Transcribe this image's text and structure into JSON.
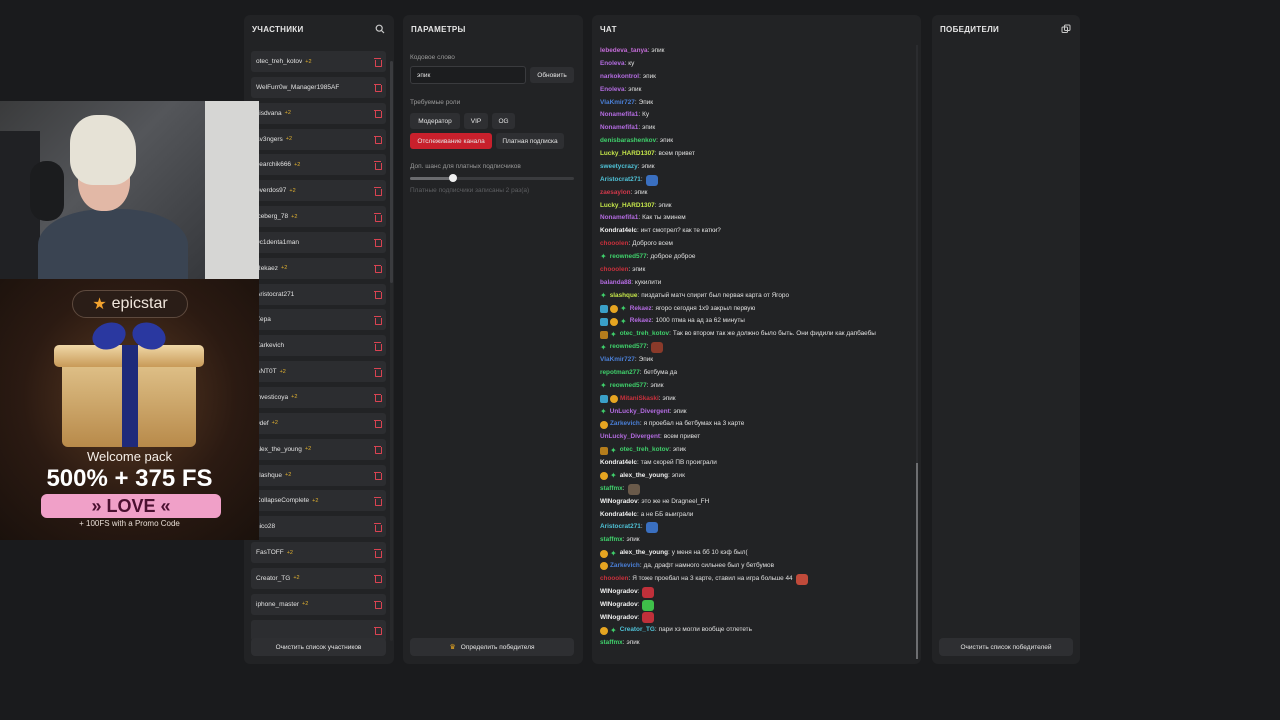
{
  "participants": {
    "title": "УЧАСТНИКИ",
    "search_icon": "search-icon",
    "badge": "+2",
    "items": [
      {
        "name": "otec_treh_kotov",
        "badge": true
      },
      {
        "name": "WelFurr0w_Manager1985AF",
        "badge": false
      },
      {
        "name": "kisdvana",
        "badge": true
      },
      {
        "name": "av3ngers",
        "badge": true
      },
      {
        "name": "searchik666",
        "badge": true
      },
      {
        "name": "overdos97",
        "badge": true
      },
      {
        "name": "iceberg_78",
        "badge": true
      },
      {
        "name": "0c1denta1man",
        "badge": false
      },
      {
        "name": "Rekaez",
        "badge": true
      },
      {
        "name": "Aristocrat271",
        "badge": false
      },
      {
        "name": "Zepa",
        "badge": false
      },
      {
        "name": "Zarkevich",
        "badge": false
      },
      {
        "name": "ANT0T",
        "badge": true
      },
      {
        "name": "investicoya",
        "badge": true
      },
      {
        "name": "0def",
        "badge": true
      },
      {
        "name": "alex_the_young",
        "badge": true
      },
      {
        "name": "slashque",
        "badge": true
      },
      {
        "name": "CollapseComplete",
        "badge": true
      },
      {
        "name": "nico28",
        "badge": false
      },
      {
        "name": "FasTOFF",
        "badge": true
      },
      {
        "name": "Creator_TG",
        "badge": true
      },
      {
        "name": "iphone_master",
        "badge": true
      },
      {
        "name": "",
        "badge": false
      }
    ],
    "clear_button": "Очистить список участников"
  },
  "params": {
    "title": "ПАРАМЕТРЫ",
    "code_word_label": "Кодовое слово",
    "code_word_value": "эпик",
    "update_button": "Обновить",
    "roles_label": "Требуемые роли",
    "roles": [
      "Модератор",
      "VIP",
      "OG"
    ],
    "role_follow": "Отслеживание канала",
    "role_paid": "Платная подписка",
    "chance_label": "Доп. шанс для платных подписчиков",
    "chance_value": 0.26,
    "chance_hint": "Платные подписчики записаны 2 раз(а)",
    "determine_button": "Определить победителя",
    "determine_icon": "crown-icon"
  },
  "chat": {
    "title": "ЧАТ",
    "messages": [
      {
        "user": "lebedeva_tanya",
        "color": "#c26bd6",
        "text": "эпик",
        "badges": []
      },
      {
        "user": "Enoleva",
        "color": "#b36be0",
        "text": "ку",
        "badges": []
      },
      {
        "user": "narkokontrol",
        "color": "#b36be0",
        "text": "эпик",
        "badges": []
      },
      {
        "user": "Enoleva",
        "color": "#b36be0",
        "text": "эпик",
        "badges": []
      },
      {
        "user": "VlaKmir727",
        "color": "#4a7fd6",
        "text": "Эпик",
        "badges": []
      },
      {
        "user": "Nonamefifa1",
        "color": "#b36be0",
        "text": "Ку",
        "badges": []
      },
      {
        "user": "Nonamefifa1",
        "color": "#b36be0",
        "text": "эпик",
        "badges": []
      },
      {
        "user": "denisbarashenkov",
        "color": "#3fd06b",
        "text": "эпик",
        "badges": []
      },
      {
        "user": "Lucky_HARD1307",
        "color": "#c5e64a",
        "text": "всем привет",
        "badges": []
      },
      {
        "user": "sweetycrazy",
        "color": "#4fc1d6",
        "text": "эпик",
        "badges": []
      },
      {
        "user": "Aristocrat271",
        "color": "#4fc1d6",
        "text": "",
        "badges": [],
        "emote": "#3a6fc0"
      },
      {
        "user": "zaesaylon",
        "color": "#d0384a",
        "text": "эпик",
        "badges": []
      },
      {
        "user": "Lucky_HARD1307",
        "color": "#c5e64a",
        "text": "эпик",
        "badges": []
      },
      {
        "user": "Nonamefifa1",
        "color": "#b36be0",
        "text": "Как ты зминем",
        "badges": []
      },
      {
        "user": "Kondrat4elc",
        "color": "#f0f0f0",
        "text": "инт смотрел? как те катки?",
        "badges": []
      },
      {
        "user": "chooolen",
        "color": "#c8303c",
        "text": "Доброго всем",
        "badges": []
      },
      {
        "user": "reowned577",
        "color": "#3fd06b",
        "text": "доброе доброе",
        "badges": [
          "green"
        ]
      },
      {
        "user": "chooolen",
        "color": "#c8303c",
        "text": "эпик",
        "badges": []
      },
      {
        "user": "balanda88",
        "color": "#b36be0",
        "text": "кукилити",
        "badges": []
      },
      {
        "user": "slashque",
        "color": "#c5e64a",
        "text": "пиздатый матч спирит был первая карта от Ягоро",
        "badges": [
          "green"
        ]
      },
      {
        "user": "Rekaez",
        "color": "#b36be0",
        "text": "ягоро сегодня 1х9 закрыл первую",
        "badges": [
          "blue",
          "gold",
          "green"
        ]
      },
      {
        "user": "Rekaez",
        "color": "#b36be0",
        "text": "1000 птма на ад за 62 минуты",
        "badges": [
          "blue",
          "gold",
          "green"
        ]
      },
      {
        "user": "otec_treh_kotov",
        "color": "#3fd06b",
        "text": "Так во втором так же должно было быть. Они фидили как дапбаебы",
        "badges": [
          "crown",
          "green"
        ]
      },
      {
        "user": "reowned577",
        "color": "#3fd06b",
        "text": "",
        "badges": [
          "green"
        ],
        "emote": "#8a3a2a"
      },
      {
        "user": "VlaKmir727",
        "color": "#4a7fd6",
        "text": "Эпик",
        "badges": []
      },
      {
        "user": "repotman277",
        "color": "#3fd06b",
        "text": "бетбума да",
        "badges": []
      },
      {
        "user": "reowned577",
        "color": "#3fd06b",
        "text": "эпик",
        "badges": [
          "green"
        ]
      },
      {
        "user": "MitaniSkaski",
        "color": "#c8303c",
        "text": "эпик",
        "badges": [
          "blue",
          "gold"
        ]
      },
      {
        "user": "UnLucky_Divergent",
        "color": "#b36be0",
        "text": "эпик",
        "badges": [
          "green"
        ]
      },
      {
        "user": "Zarkevich",
        "color": "#4a7fd6",
        "text": "я проебал на бетбумах на 3 карте",
        "badges": [
          "gold"
        ]
      },
      {
        "user": "UnLucky_Divergent",
        "color": "#b36be0",
        "text": "всем привет",
        "badges": []
      },
      {
        "user": "otec_treh_kotov",
        "color": "#3fd06b",
        "text": "эпик",
        "badges": [
          "crown",
          "green"
        ]
      },
      {
        "user": "Kondrat4elc",
        "color": "#f0f0f0",
        "text": "там скорей ПВ проиграли",
        "badges": []
      },
      {
        "user": "alex_the_young",
        "color": "#f0f0f0",
        "text": "эпик",
        "badges": [
          "gold",
          "green"
        ]
      },
      {
        "user": "staffmx",
        "color": "#3fd06b",
        "text": "",
        "badges": [],
        "emote": "#6a5a4a"
      },
      {
        "user": "WINogradov",
        "color": "#f0f0f0",
        "text": "это же не Dragneel_FH",
        "badges": []
      },
      {
        "user": "Kondrat4elc",
        "color": "#f0f0f0",
        "text": "а не ББ выиграли",
        "badges": []
      },
      {
        "user": "Aristocrat271",
        "color": "#4fc1d6",
        "text": "",
        "badges": [],
        "emote": "#3a6fc0"
      },
      {
        "user": "staffmx",
        "color": "#3fd06b",
        "text": "эпик",
        "badges": []
      },
      {
        "user": "alex_the_young",
        "color": "#f0f0f0",
        "text": "у меня на бб 10 кэф был(",
        "badges": [
          "gold",
          "green"
        ]
      },
      {
        "user": "Zarkevich",
        "color": "#4a7fd6",
        "text": "да, драфт намного сильнее был у бетбумов",
        "badges": [
          "gold"
        ]
      },
      {
        "user": "chooolen",
        "color": "#c8303c",
        "text": "Я тоже проебал на 3 карте, ставил на игра больше 44",
        "badges": [],
        "emote": "#c04a3a"
      },
      {
        "user": "WINogradov",
        "color": "#f0f0f0",
        "text": "",
        "badges": [],
        "emote": "#c0303a"
      },
      {
        "user": "WINogradov",
        "color": "#f0f0f0",
        "text": "",
        "badges": [],
        "emote": "#3fc04a"
      },
      {
        "user": "WINogradov",
        "color": "#f0f0f0",
        "text": "",
        "badges": [],
        "emote": "#c0303a"
      },
      {
        "user": "Creator_TG",
        "color": "#4fc1d6",
        "text": "пари хз могли вообще отлететь",
        "badges": [
          "gold",
          "green"
        ]
      },
      {
        "user": "staffmx",
        "color": "#3fd06b",
        "text": "эпик",
        "badges": []
      }
    ]
  },
  "winners": {
    "title": "ПОБЕДИТЕЛИ",
    "icon": "copy-icon",
    "clear_button": "Очистить список победителей"
  },
  "ad": {
    "brand": "epicstar",
    "line1": "Welcome pack",
    "line2": "500% + 375 FS",
    "pill": "» LOVE «",
    "line3": "+ 100FS with a Promo Code"
  }
}
